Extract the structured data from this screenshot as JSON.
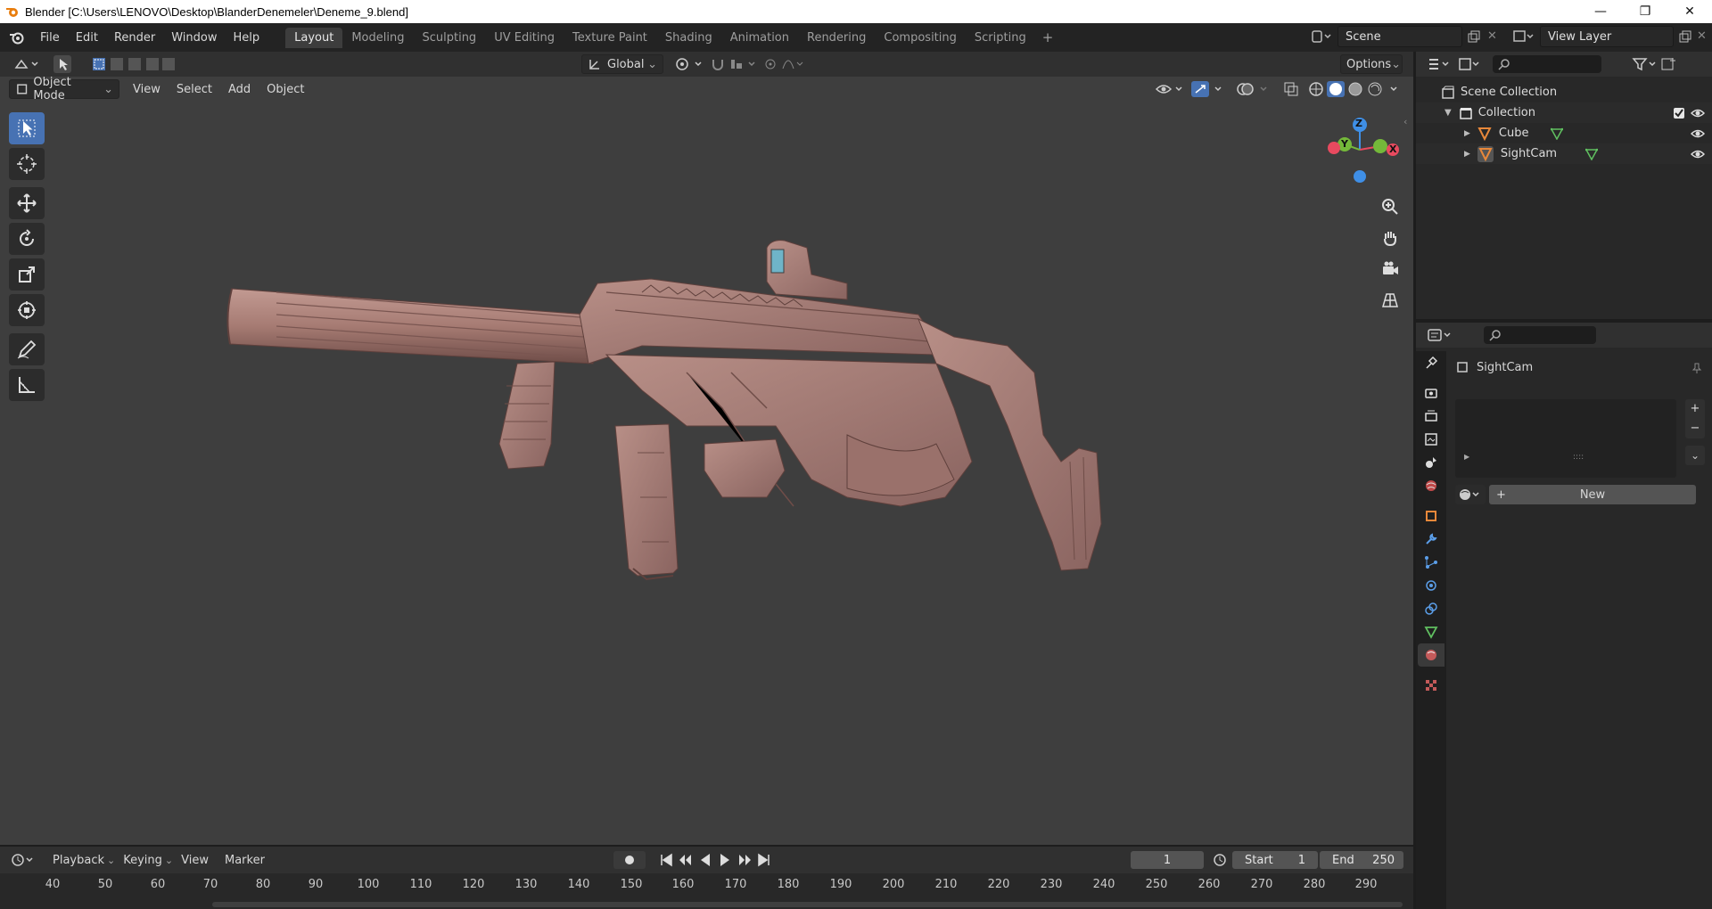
{
  "window": {
    "title": "Blender [C:\\Users\\LENOVO\\Desktop\\BlanderDenemeler\\Deneme_9.blend]",
    "controls": [
      "—",
      "❐",
      "✕"
    ]
  },
  "menu": {
    "items": [
      "File",
      "Edit",
      "Render",
      "Window",
      "Help"
    ]
  },
  "workspaces": {
    "tabs": [
      "Layout",
      "Modeling",
      "Sculpting",
      "UV Editing",
      "Texture Paint",
      "Shading",
      "Animation",
      "Rendering",
      "Compositing",
      "Scripting"
    ],
    "active": "Layout",
    "add": "+"
  },
  "scene": {
    "name": "Scene",
    "view_layer": "View Layer"
  },
  "viewport": {
    "transform_orientation": "Global",
    "options_label": "Options",
    "mode": "Object Mode",
    "menus": [
      "View",
      "Select",
      "Add",
      "Object"
    ],
    "gizmo_axes": {
      "z": "Z",
      "y": "Y",
      "x": "X"
    }
  },
  "outliner": {
    "root": "Scene Collection",
    "collection": "Collection",
    "objects": [
      {
        "name": "Cube"
      },
      {
        "name": "SightCam"
      }
    ]
  },
  "properties": {
    "object_name": "SightCam",
    "new_button": "New",
    "list_handle": "::::"
  },
  "timeline": {
    "menus": [
      "Playback",
      "Keying",
      "View",
      "Marker"
    ],
    "current_frame": "1",
    "start_label": "Start",
    "start": "1",
    "end_label": "End",
    "end": "250",
    "ruler": [
      "40",
      "50",
      "60",
      "70",
      "80",
      "90",
      "100",
      "110",
      "120",
      "130",
      "140",
      "150",
      "160",
      "170",
      "180",
      "190",
      "200",
      "210",
      "220",
      "230",
      "240",
      "250",
      "260",
      "270",
      "280",
      "290"
    ]
  },
  "colors": {
    "accent": "#4772b3",
    "axis_x": "#e84a5f",
    "axis_y": "#74b83a",
    "axis_z": "#3f8fe6",
    "model": "#a67b73"
  }
}
